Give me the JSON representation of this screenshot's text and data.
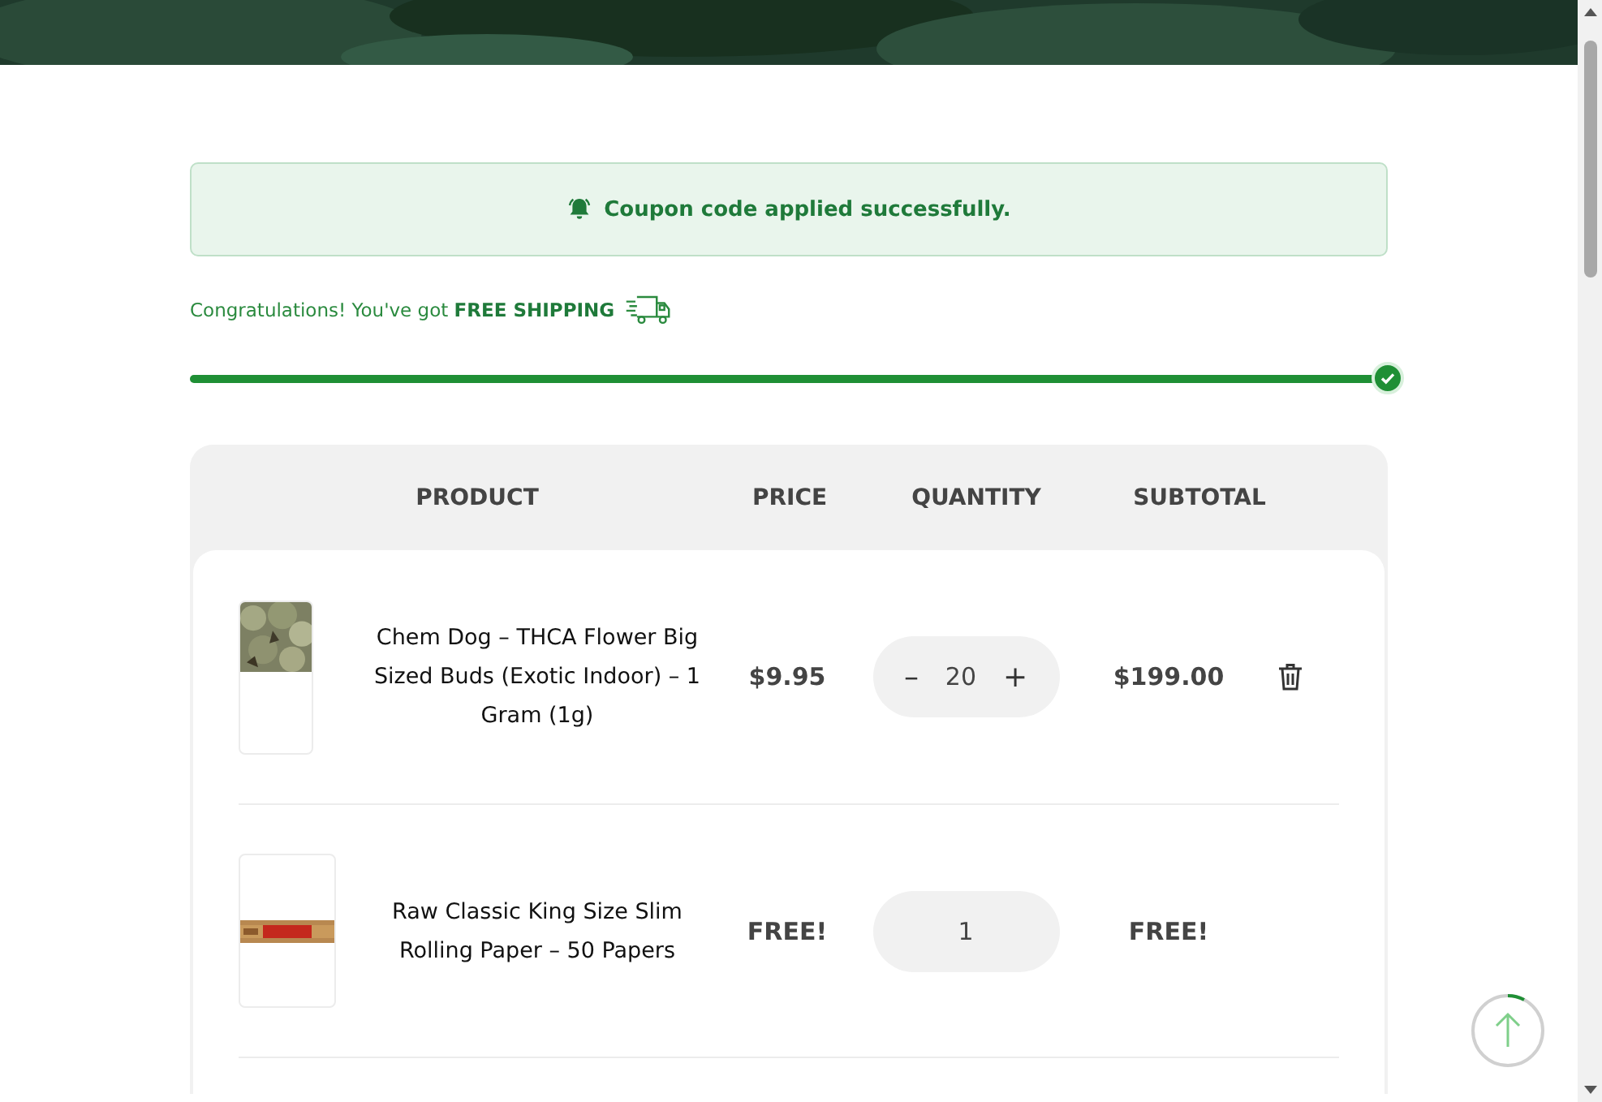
{
  "notice": {
    "message": "Coupon code applied successfully."
  },
  "shipping": {
    "text": "Congratulations! You've got **FREE SHIPPING**",
    "level": 1
  },
  "table": {
    "columns": [
      "PRODUCT",
      "PRICE",
      "QUANTITY",
      "SUBTOTAL"
    ],
    "rows": [
      {
        "kind": "paid",
        "name": "Chem Dog – THCA Flower Big Sized Buds (Exotic Indoor) – 1 Gram (1g)",
        "price": "$9.95",
        "quantity": "20",
        "minus": "–",
        "plus": "+",
        "subtotal": "$199.00"
      },
      {
        "kind": "gift",
        "name": "Raw Classic King Size Slim Rolling Paper – 50 Papers",
        "price": "FREE!",
        "quantity": "1",
        "subtotal": "FREE!"
      }
    ]
  }
}
